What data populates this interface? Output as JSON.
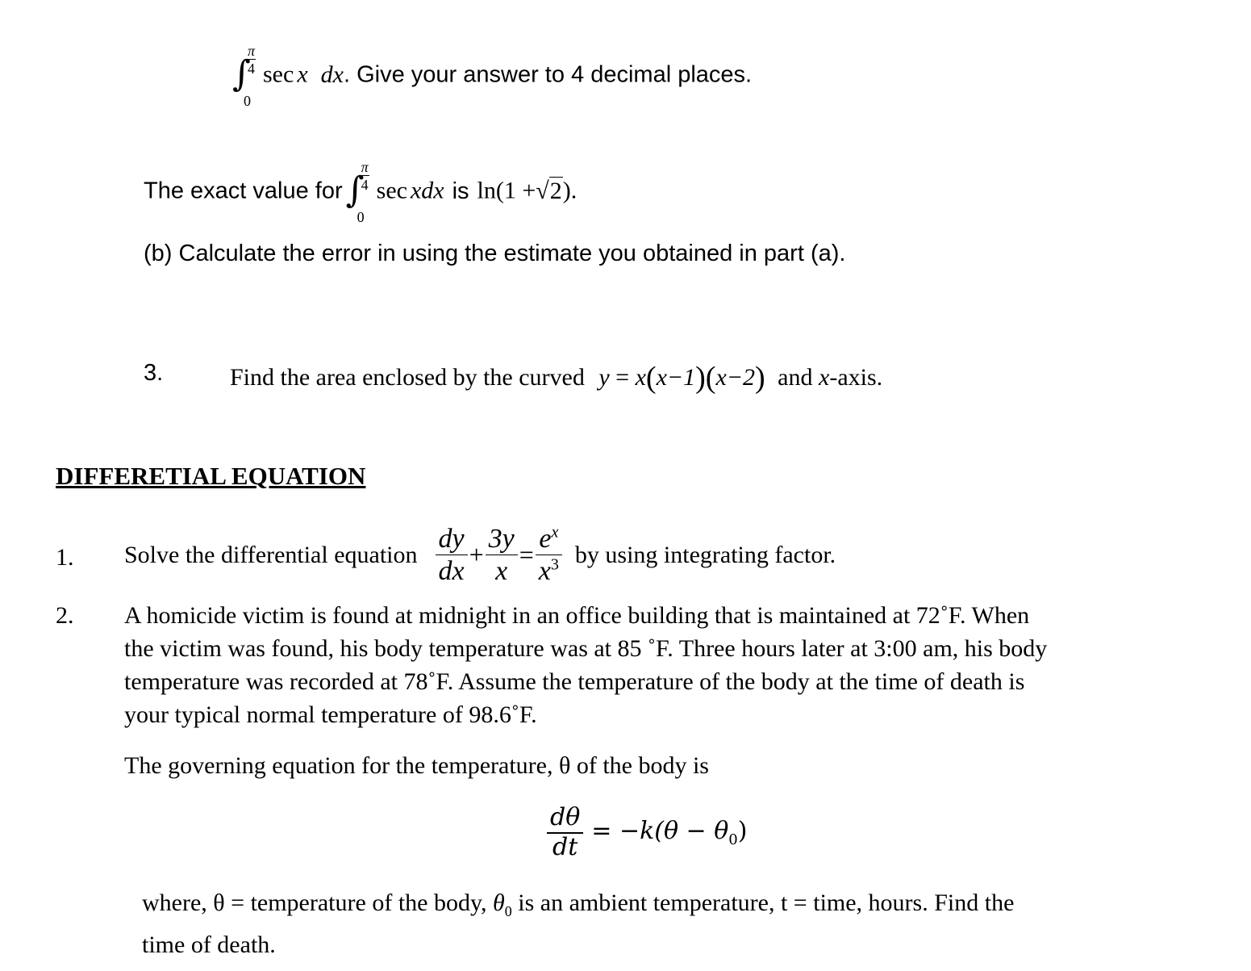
{
  "document": {
    "q2_part_a_tail": {
      "integral": {
        "lower": "0",
        "upper_num": "π",
        "upper_den": "4",
        "integrand": "sec",
        "var": "x",
        "dx": "dx"
      },
      "text": ". Give your answer to 4 decimal places."
    },
    "exact_value": {
      "prefix": "The exact value for",
      "integral": {
        "lower": "0",
        "upper_num": "π",
        "upper_den": "4",
        "integrand": "sec",
        "var": "xdx"
      },
      "is": "is",
      "result_prefix": "ln(1 +",
      "sqrt_arg": "2",
      "result_suffix": ")."
    },
    "part_b": "(b) Calculate the error in using the estimate you obtained in part (a).",
    "q3": {
      "number": "3.",
      "text": "Find the area enclosed by the curved",
      "equation": {
        "lhs": "y",
        "eq": "=",
        "x": "x",
        "f1": "x−1",
        "f2": "x−2"
      },
      "suffix_and": "and",
      "suffix_axis_var": "x",
      "suffix_axis": "-axis."
    },
    "section_heading": "DIFFERETIAL EQUATION",
    "de_q1": {
      "number": "1.",
      "text": "Solve the differential equation",
      "frac1": {
        "num": "dy",
        "den": "dx"
      },
      "plus": "+",
      "frac2": {
        "num": "3y",
        "den": "x"
      },
      "equals": "=",
      "frac3": {
        "num": "e",
        "num_sup": "x",
        "den": "x",
        "den_sup": "3"
      },
      "suffix": "by using integrating factor."
    },
    "de_q2": {
      "number": "2.",
      "lines": [
        "A homicide victim is found at midnight in an office building that is maintained at 72˚F. When",
        "the victim was found, his body temperature was at 85 ˚F. Three hours later at 3:00 am, his body",
        "temperature was recorded at 78˚F. Assume the temperature of the body at the time of death is",
        "your typical normal temperature of 98.6˚F."
      ],
      "governing": "The governing equation for the temperature, θ of the body is",
      "equation": {
        "num": "dθ",
        "den": "dt",
        "rhs": "= −k(θ − θ",
        "rhs_sub": "0",
        "rhs_end": ")"
      },
      "where_line1_a": "where, θ = temperature of the body,",
      "where_theta0": "θ",
      "where_theta0_sub": "0",
      "where_line1_b": "is an ambient temperature, t = time, hours. Find the",
      "where_line2": "time of death."
    }
  }
}
